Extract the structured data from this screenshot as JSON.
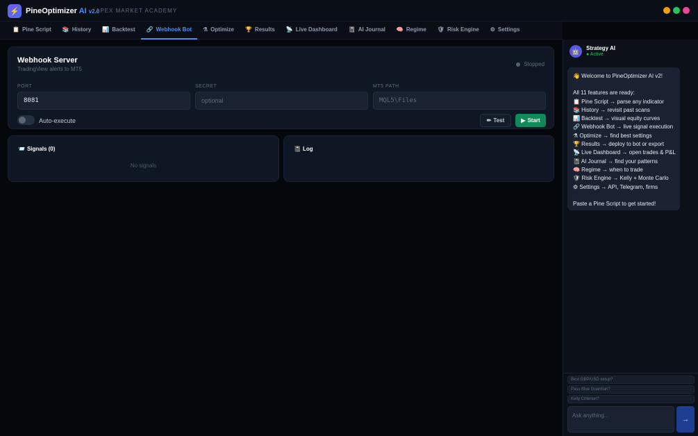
{
  "app": {
    "logo_glyph": "⚡",
    "name": "PineOptimizer",
    "name_ai": "AI",
    "version": "v2.0",
    "subtitle": "APEX MARKET ACADEMY"
  },
  "window_controls": {
    "minimize_color": "#f59e0b",
    "maximize_color": "#22c55e",
    "close_color": "#ec4899"
  },
  "tabs": [
    {
      "icon": "📋",
      "label": "Pine Script"
    },
    {
      "icon": "📚",
      "label": "History"
    },
    {
      "icon": "📊",
      "label": "Backtest"
    },
    {
      "icon": "🔗",
      "label": "Webhook Bot"
    },
    {
      "icon": "⚗",
      "label": "Optimize"
    },
    {
      "icon": "🏆",
      "label": "Results"
    },
    {
      "icon": "📡",
      "label": "Live Dashboard"
    },
    {
      "icon": "📓",
      "label": "AI Journal"
    },
    {
      "icon": "🧠",
      "label": "Regime"
    },
    {
      "icon": "🛡",
      "label": "Risk Engine"
    },
    {
      "icon": "⚙",
      "label": "Settings"
    }
  ],
  "active_tab": "Webhook Bot",
  "webhook": {
    "title": "Webhook Server",
    "subtitle": "TradingView alerts to MT5",
    "status": "Stopped",
    "port_label": "PORT",
    "port_value": "8081",
    "secret_label": "SECRET",
    "secret_placeholder": "optional",
    "mt5_label": "MT5 PATH",
    "mt5_placeholder": "MQL5\\Files",
    "auto_execute_label": "Auto-execute",
    "auto_execute_on": false,
    "test_icon": "✏",
    "test_label": "Test",
    "start_icon": "▶",
    "start_label": "Start"
  },
  "signals": {
    "icon": "📨",
    "title": "Signals (0)",
    "empty": "No signals"
  },
  "log": {
    "icon": "📓",
    "title": "Log"
  },
  "assistant": {
    "avatar": "🤖",
    "name": "Strategy AI",
    "status": "● Active",
    "message": {
      "greeting": "👋 Welcome to PineOptimizer AI v2!",
      "intro": "All 11 features are ready:",
      "features": [
        "📋 Pine Script → parse any indicator",
        "📚 History → revisit past scans",
        "📊 Backtest → visual equity curves",
        "🔗 Webhook Bot → live signal execution",
        "⚗ Optimize → find best settings",
        "🏆 Results → deploy to bot or export",
        "📡 Live Dashboard → open trades & P&L",
        "📓 AI Journal → find your patterns",
        "🧠 Regime → when to trade",
        "🛡 Risk Engine → Kelly + Monte Carlo",
        "⚙ Settings → API, Telegram, firms"
      ],
      "outro": "Paste a Pine Script to get started!"
    },
    "suggestions": [
      "Best GBP/USD setup?",
      "Pass Blue Guardian?",
      "Kelly Criterion?"
    ],
    "input_placeholder": "Ask anything...",
    "send_glyph": "→"
  }
}
